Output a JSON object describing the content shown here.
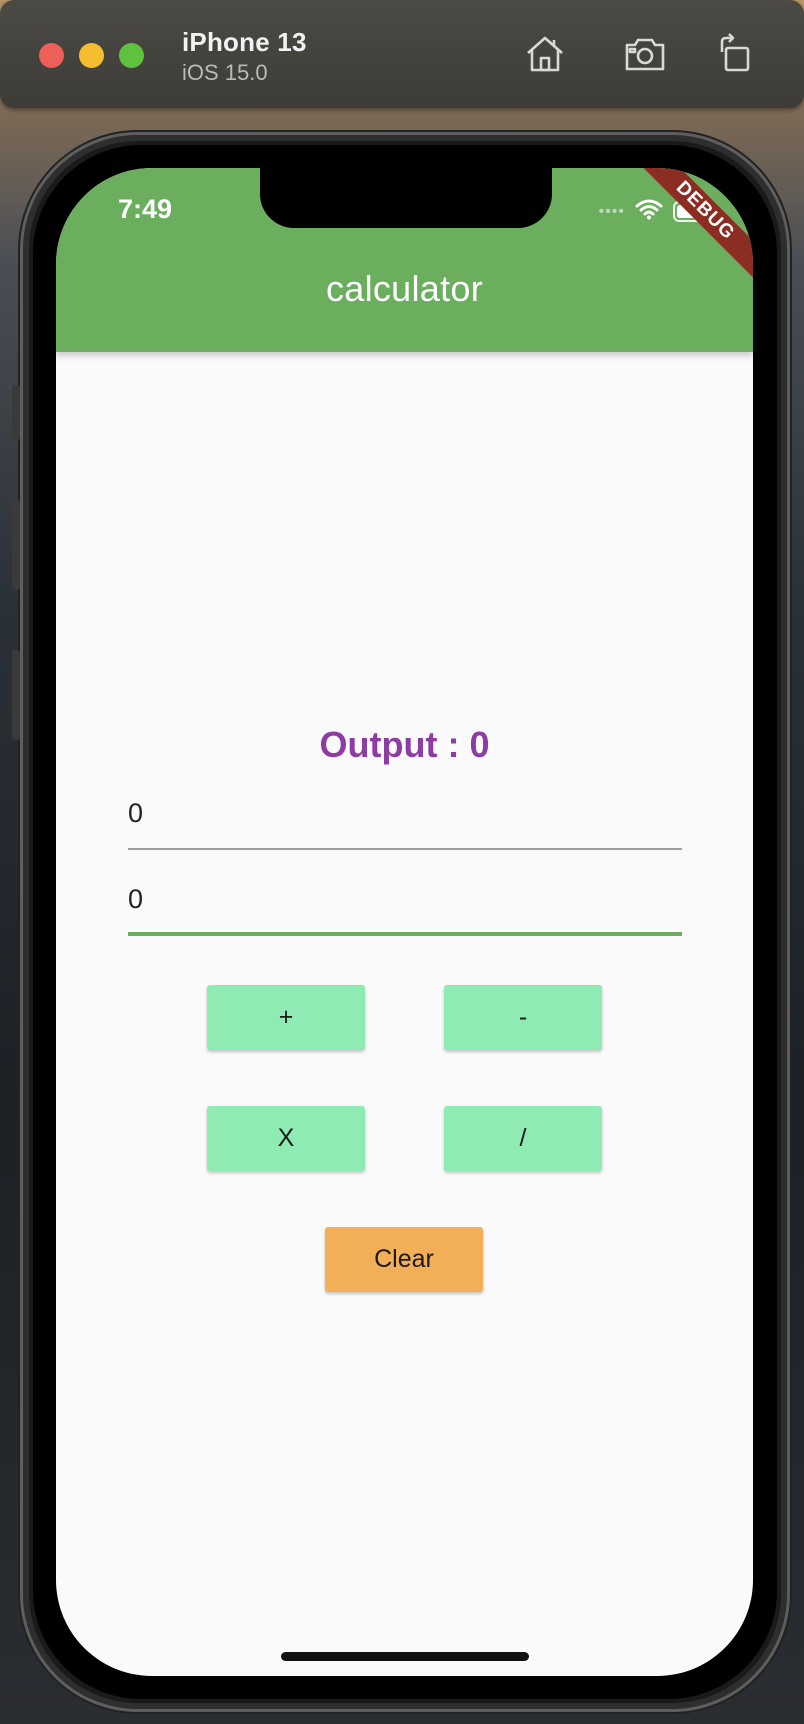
{
  "simulator": {
    "device_name": "iPhone 13",
    "os_version": "iOS 15.0",
    "icons": [
      "home-icon",
      "screenshot-icon",
      "rotate-icon"
    ]
  },
  "status_bar": {
    "time": "7:49",
    "signal": "••••",
    "debug_banner": "DEBUG"
  },
  "app_bar": {
    "title": "calculator",
    "color": "#6aae5e"
  },
  "main": {
    "output_text": "Output : 0",
    "output_color": "#8e3ca4",
    "input1_value": "0",
    "input2_value": "0",
    "buttons": {
      "add": "+",
      "subtract": "-",
      "multiply": "X",
      "divide": "/",
      "clear": "Clear"
    },
    "op_button_color": "#8eebb3",
    "clear_button_color": "#f3ae58"
  }
}
